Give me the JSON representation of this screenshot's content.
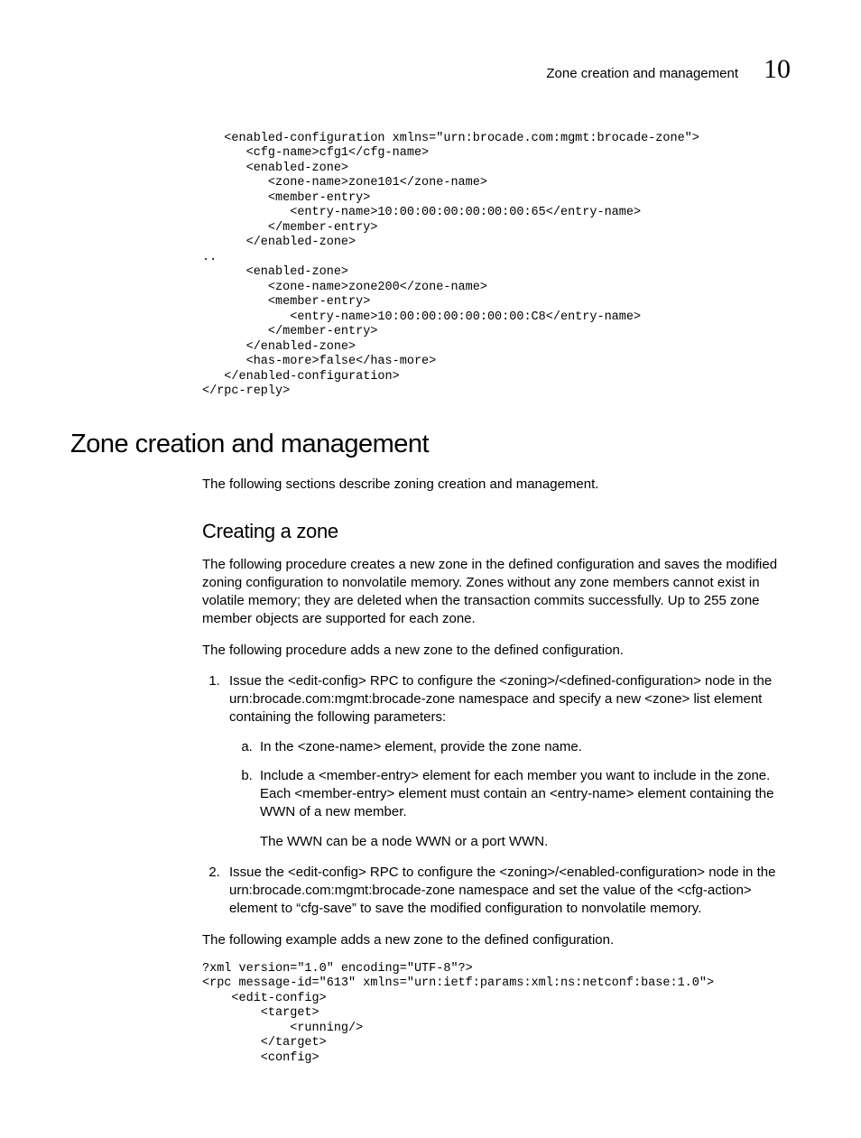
{
  "header": {
    "title": "Zone creation and management",
    "chapter_number": "10"
  },
  "code_block_top": "   <enabled-configuration xmlns=\"urn:brocade.com:mgmt:brocade-zone\">\n      <cfg-name>cfg1</cfg-name>\n      <enabled-zone>\n         <zone-name>zone101</zone-name>\n         <member-entry>\n            <entry-name>10:00:00:00:00:00:00:65</entry-name>\n         </member-entry>\n      </enabled-zone>\n..\n      <enabled-zone>\n         <zone-name>zone200</zone-name>\n         <member-entry>\n            <entry-name>10:00:00:00:00:00:00:C8</entry-name>\n         </member-entry>\n      </enabled-zone>\n      <has-more>false</has-more>\n   </enabled-configuration>\n</rpc-reply>",
  "h1": "Zone creation and management",
  "intro": "The following sections describe zoning creation and management.",
  "h2": "Creating a zone",
  "p1": "The following procedure creates a new zone in the defined configuration and saves the modified zoning configuration to nonvolatile memory. Zones without any zone members cannot exist in volatile memory; they are deleted when the transaction commits successfully. Up to 255 zone member objects are supported for each zone.",
  "p2": "The following procedure adds a new zone to the defined configuration.",
  "step1": "Issue the <edit-config> RPC to configure the <zoning>/<defined-configuration> node in the urn:brocade.com:mgmt:brocade-zone namespace and specify a new <zone> list element containing the following parameters:",
  "step1a": "In the <zone-name> element, provide the zone name.",
  "step1b": "Include a <member-entry> element for each member you want to include in the zone. Each <member-entry> element must contain an <entry-name> element containing the WWN of a new member.",
  "step1b_note": "The WWN can be a node WWN or a port WWN.",
  "step2": "Issue the <edit-config> RPC to configure the <zoning>/<enabled-configuration> node in the urn:brocade.com:mgmt:brocade-zone namespace and set the value of the <cfg-action> element to “cfg-save” to save the modified configuration to nonvolatile memory.",
  "p3": "The following example adds a new zone to the defined configuration.",
  "code_block_bottom": "?xml version=\"1.0\" encoding=\"UTF-8\"?>\n<rpc message-id=\"613\" xmlns=\"urn:ietf:params:xml:ns:netconf:base:1.0\">\n    <edit-config>\n        <target>\n            <running/>\n        </target>\n        <config>"
}
